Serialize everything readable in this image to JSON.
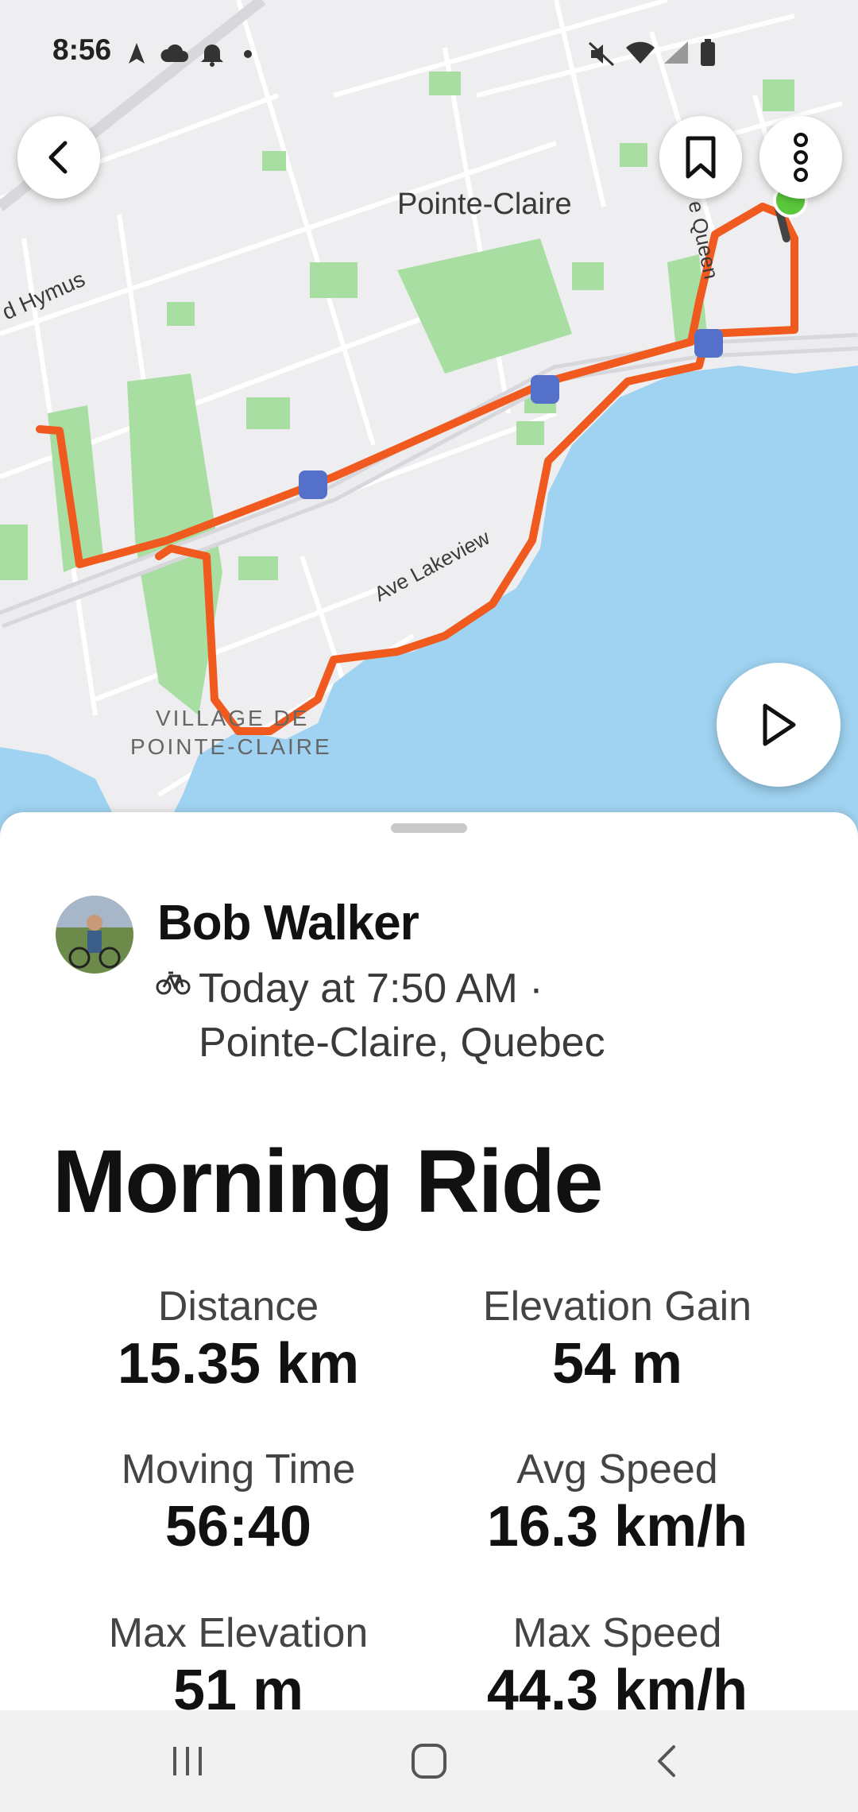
{
  "status_bar": {
    "time": "8:56"
  },
  "map": {
    "labels": {
      "city": "Pointe-Claire",
      "hymus": "d Hymus",
      "queen": "e Queen",
      "lakeview": "Ave Lakeview",
      "village_line1": "VILLAGE DE",
      "village_line2": "POINTE-CLAIRE"
    },
    "colors": {
      "route": "#f05a1e",
      "water": "#9fd3f1",
      "park": "#a9dea3",
      "start": "#5ac83c"
    },
    "buttons": {
      "back": "chevron-left-icon",
      "bookmark": "bookmark-icon",
      "more": "more-vertical-icon",
      "play": "play-icon"
    }
  },
  "activity": {
    "athlete": "Bob Walker",
    "sport_icon": "bicycle-icon",
    "when": "Today at 7:50 AM ·",
    "where": "Pointe-Claire, Quebec",
    "title": "Morning Ride",
    "stats": [
      {
        "label": "Distance",
        "value": "15.35 km"
      },
      {
        "label": "Elevation Gain",
        "value": "54 m"
      },
      {
        "label": "Moving Time",
        "value": "56:40"
      },
      {
        "label": "Avg Speed",
        "value": "16.3 km/h"
      },
      {
        "label": "Max Elevation",
        "value": "51 m"
      },
      {
        "label": "Max Speed",
        "value": "44.3 km/h"
      }
    ]
  },
  "nav_bar": {
    "icons": [
      "recents-icon",
      "home-icon",
      "back-icon"
    ]
  }
}
